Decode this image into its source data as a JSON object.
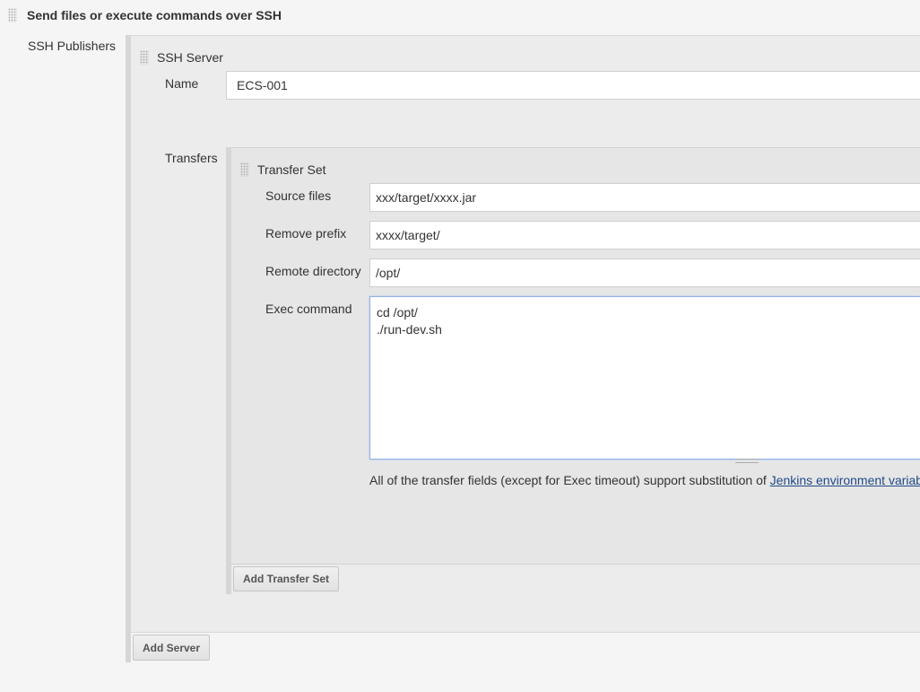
{
  "section": {
    "title": "Send files or execute commands over SSH"
  },
  "publishers": {
    "label": "SSH Publishers"
  },
  "ssh_server": {
    "title": "SSH Server",
    "name_label": "Name",
    "name_value": "ECS-001",
    "transfers_label": "Transfers",
    "add_server_label": "Add Server"
  },
  "transfer_set": {
    "title": "Transfer Set",
    "source_files_label": "Source files",
    "source_files_value": "xxx/target/xxxx.jar",
    "remove_prefix_label": "Remove prefix",
    "remove_prefix_value": "xxxx/target/",
    "remote_directory_label": "Remote directory",
    "remote_directory_value": "/opt/",
    "exec_command_label": "Exec command",
    "exec_command_line1": "cd /opt/",
    "exec_command_line2": "./run-dev.sh",
    "help_text": "All of the transfer fields (except for Exec timeout) support substitution of ",
    "help_link": "Jenkins environment variab",
    "add_transfer_set_label": "Add Transfer Set"
  }
}
